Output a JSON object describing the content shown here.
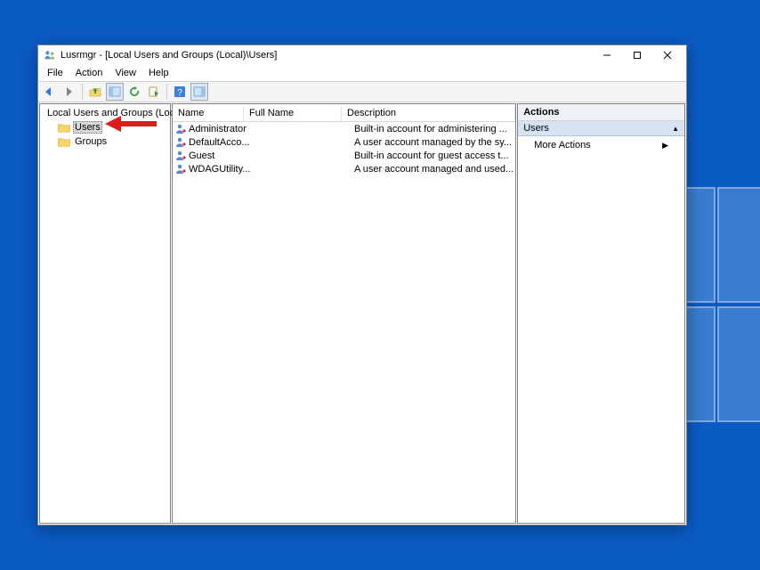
{
  "window": {
    "title": "Lusrmgr - [Local Users and Groups (Local)\\Users]"
  },
  "menu": {
    "file": "File",
    "action": "Action",
    "view": "View",
    "help": "Help"
  },
  "tree": {
    "root": "Local Users and Groups (Local)",
    "users": "Users",
    "groups": "Groups"
  },
  "list": {
    "cols": {
      "name": "Name",
      "full": "Full Name",
      "desc": "Description"
    },
    "rows": [
      {
        "name": "Administrator",
        "full": "",
        "desc": "Built-in account for administering ..."
      },
      {
        "name": "DefaultAcco...",
        "full": "",
        "desc": "A user account managed by the sy..."
      },
      {
        "name": "Guest",
        "full": "",
        "desc": "Built-in account for guest access t..."
      },
      {
        "name": "WDAGUtility...",
        "full": "",
        "desc": "A user account managed and used..."
      }
    ]
  },
  "actions": {
    "header": "Actions",
    "section": "Users",
    "more": "More Actions"
  }
}
